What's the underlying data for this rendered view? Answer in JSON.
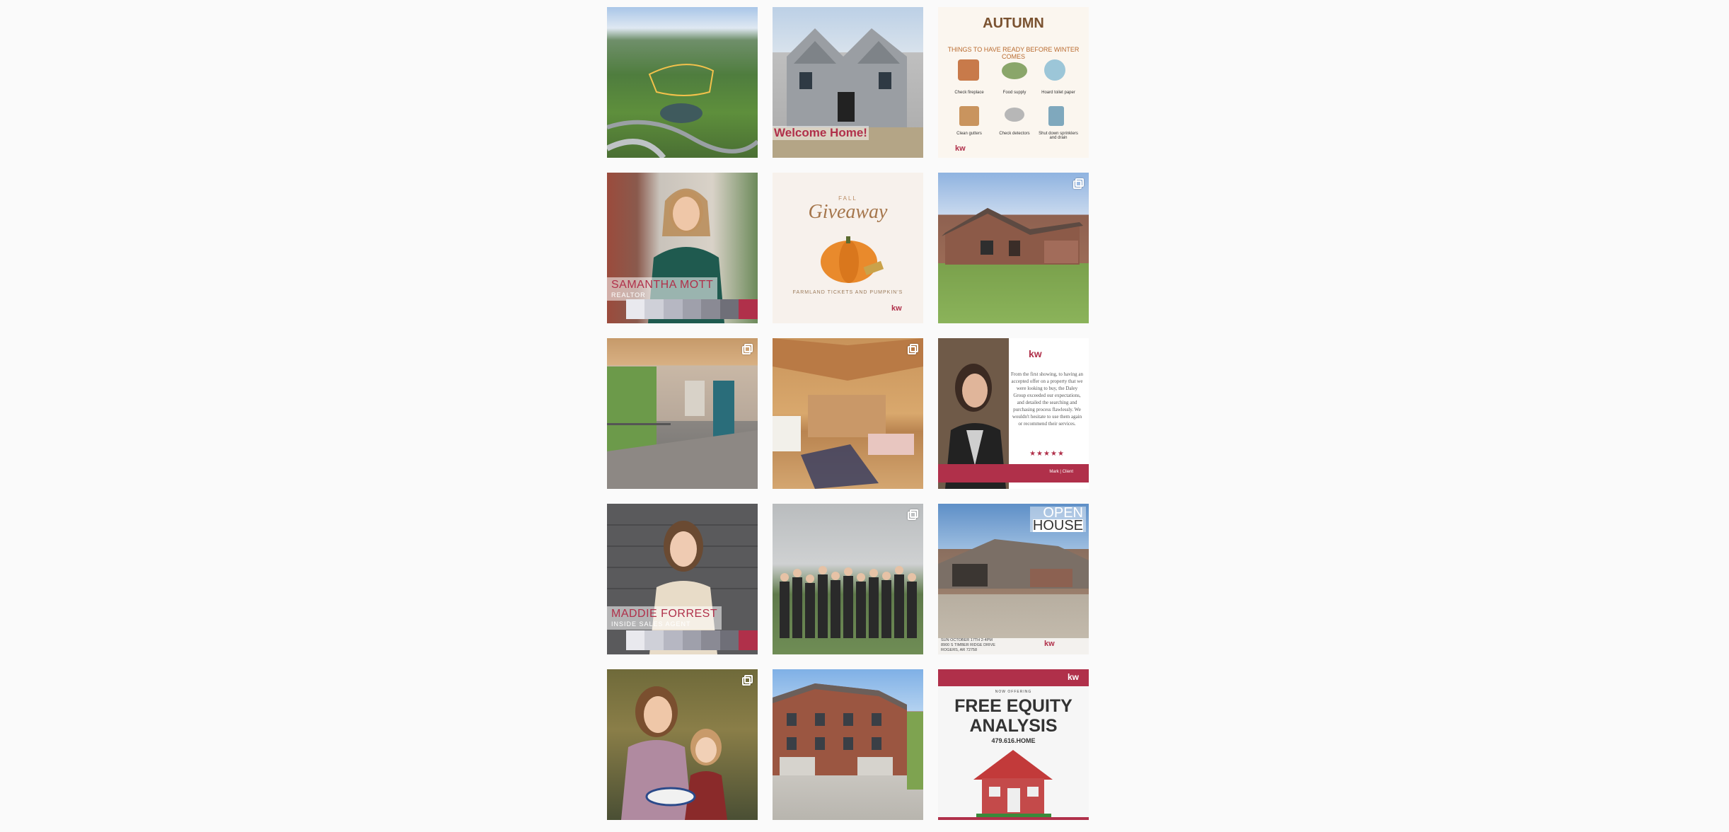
{
  "posts": {
    "p3": {
      "title": "AUTUMN",
      "subtitle": "THINGS TO HAVE READY BEFORE WINTER COMES",
      "items": [
        "Check fireplace",
        "Food supply",
        "Hoard toilet paper",
        "Clean gutters",
        "Check detectors",
        "Shut down sprinklers and drain"
      ],
      "logo": "kw"
    },
    "p2": {
      "caption": "Welcome Home!"
    },
    "p4": {
      "name": "SAMANTHA MOTT",
      "role": "REALTOR"
    },
    "p5": {
      "small": "FALL",
      "title": "Giveaway",
      "footer": "FARMLAND TICKETS AND PUMPKIN'S",
      "logo": "kw"
    },
    "p9": {
      "logo": "kw",
      "quote": "From the first showing, to having an accepted offer on a property that we were looking to buy, the Daley Group exceeded our expectations, and detailed the searching and purchasing process flawlessly. We wouldn't hesitate to use them again or recommend their services.",
      "stars": "★★★★★",
      "attribution": "Mark | Client"
    },
    "p10": {
      "name": "MADDIE FORREST",
      "role": "INSIDE SALES AGENT"
    },
    "p12": {
      "top1": "OPEN",
      "top2": "HOUSE",
      "line1": "SUN OCTOBER 17TH 2-4PM",
      "line2": "8900 S TIMBER RIDGE DRIVE",
      "line3": "ROGERS, AR 72758",
      "logo": "kw"
    },
    "p15": {
      "small": "NOW OFFERING",
      "title1": "FREE EQUITY",
      "title2": "ANALYSIS",
      "phone": "479.616.HOME",
      "logo": "kw"
    }
  },
  "colors": {
    "brand_red": "#b0304a",
    "background": "#fafafa"
  }
}
